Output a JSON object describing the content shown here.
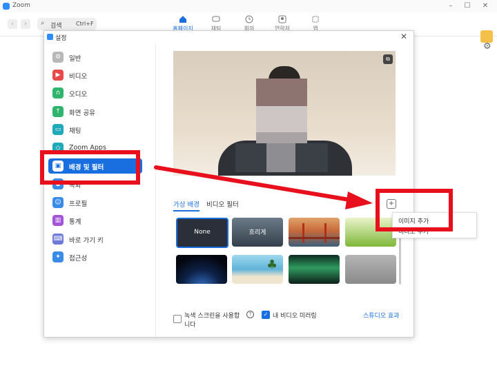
{
  "window": {
    "title": "Zoom"
  },
  "toolbar": {
    "search_label": "검색",
    "search_shortcut": "Ctrl+F",
    "tabs": [
      {
        "label": "홈페이지",
        "active": true
      },
      {
        "label": "채팅"
      },
      {
        "label": "회의"
      },
      {
        "label": "연락처"
      },
      {
        "label": "앱"
      }
    ]
  },
  "settings": {
    "title": "설정",
    "nav": [
      {
        "label": "일반",
        "icon": "gear-icon",
        "color": "#9e9e9e"
      },
      {
        "label": "비디오",
        "icon": "video-icon",
        "color": "#e84a4a"
      },
      {
        "label": "오디오",
        "icon": "headphones-icon",
        "color": "#2fb56b"
      },
      {
        "label": "화면 공유",
        "icon": "screen-share-icon",
        "color": "#2fb56b"
      },
      {
        "label": "채팅",
        "icon": "chat-icon",
        "color": "#1fa9b8"
      },
      {
        "label": "Zoom Apps",
        "icon": "apps-icon",
        "color": "#1fa9b8"
      },
      {
        "label": "배경 및 필터",
        "icon": "background-icon",
        "color": "#ffffff",
        "selected": true
      },
      {
        "label": "녹화",
        "icon": "record-icon",
        "color": "#3a8be8"
      },
      {
        "label": "프로필",
        "icon": "profile-icon",
        "color": "#3a8be8"
      },
      {
        "label": "통계",
        "icon": "stats-icon",
        "color": "#a355d6"
      },
      {
        "label": "바로 가기 키",
        "icon": "keyboard-icon",
        "color": "#6d7ad8"
      },
      {
        "label": "접근성",
        "icon": "accessibility-icon",
        "color": "#3a8be8"
      }
    ],
    "tabs": [
      {
        "label": "가상 배경",
        "active": true
      },
      {
        "label": "비디오 필터"
      }
    ],
    "backgrounds": [
      {
        "label": "None",
        "selected": true,
        "color": "#2b2f3a"
      },
      {
        "label": "흐리게",
        "color": "#4a5868"
      },
      {
        "label": "",
        "color": "#c86a3a",
        "name": "golden-gate"
      },
      {
        "label": "",
        "color": "#7fb83a",
        "name": "grass"
      },
      {
        "label": "",
        "color": "#0d2248",
        "name": "earth"
      },
      {
        "label": "",
        "color": "#5fb3d8",
        "name": "beach"
      },
      {
        "label": "",
        "color": "#1f5a3f",
        "name": "aurora"
      },
      {
        "label": "",
        "color": "#9a9a9a",
        "name": "gray"
      }
    ],
    "green_screen_label": "녹색 스크린을 사용합니다",
    "green_screen_line1": "녹색 스크린을 사용합",
    "green_screen_line2": "니다",
    "mirror_label": "내 비디오 미러링",
    "studio_effects_label": "스튜디오 효과",
    "add_menu": {
      "add_image": "이미지 추가",
      "add_video": "비디오 추가"
    }
  },
  "annotation": {
    "color": "#e8101d"
  }
}
